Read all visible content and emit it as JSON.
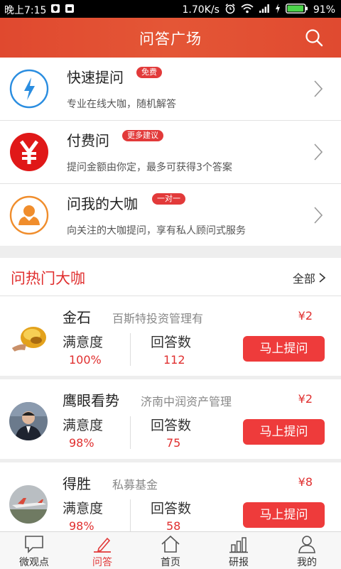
{
  "status_bar": {
    "time": "晚上7:15",
    "network_speed": "1.70K/s",
    "battery": "91%",
    "icons": [
      "shield-icon",
      "sim-icon",
      "alarm-icon",
      "wifi-icon",
      "signal-icon",
      "charging-icon",
      "battery-icon"
    ]
  },
  "header": {
    "title": "问答广场",
    "search_icon": "search-icon"
  },
  "ask_options": [
    {
      "title": "快速提问",
      "badge": "免费",
      "desc": "专业在线大咖，随机解答",
      "icon": "lightning-icon",
      "color": "#2a8de0"
    },
    {
      "title": "付费问",
      "badge": "更多建议",
      "desc": "提问金额由你定，最多可获得3个答案",
      "icon": "yen-icon",
      "color": "#e01818"
    },
    {
      "title": "问我的大咖",
      "badge": "一对一",
      "desc": "向关注的大咖提问，享有私人顾问式服务",
      "icon": "person-icon",
      "color": "#f08d2c"
    }
  ],
  "hot": {
    "title": "问热门大咖",
    "all_label": "全部"
  },
  "experts": [
    {
      "name": "金石",
      "org": "百斯特投资管理有",
      "price": "¥2",
      "satisfaction_label": "满意度",
      "satisfaction": "100%",
      "answers_label": "回答数",
      "answers": "112",
      "ask_label": "马上提问"
    },
    {
      "name": "鹰眼看势",
      "org": "济南中润资产管理",
      "price": "¥2",
      "satisfaction_label": "满意度",
      "satisfaction": "98%",
      "answers_label": "回答数",
      "answers": "75",
      "ask_label": "马上提问"
    },
    {
      "name": "得胜",
      "org": "私募基金",
      "price": "¥8",
      "satisfaction_label": "满意度",
      "satisfaction": "98%",
      "answers_label": "回答数",
      "answers": "58",
      "ask_label": "马上提问"
    }
  ],
  "tabs": [
    {
      "label": "微观点",
      "icon": "chat-bubble-icon",
      "active": false
    },
    {
      "label": "问答",
      "icon": "edit-icon",
      "active": true
    },
    {
      "label": "首页",
      "icon": "home-icon",
      "active": false
    },
    {
      "label": "研报",
      "icon": "bar-chart-icon",
      "active": false
    },
    {
      "label": "我的",
      "icon": "user-icon",
      "active": false
    }
  ],
  "colors": {
    "brand_red": "#e23a3a",
    "header": "#e04a30",
    "accent_text": "#e02f2f"
  }
}
